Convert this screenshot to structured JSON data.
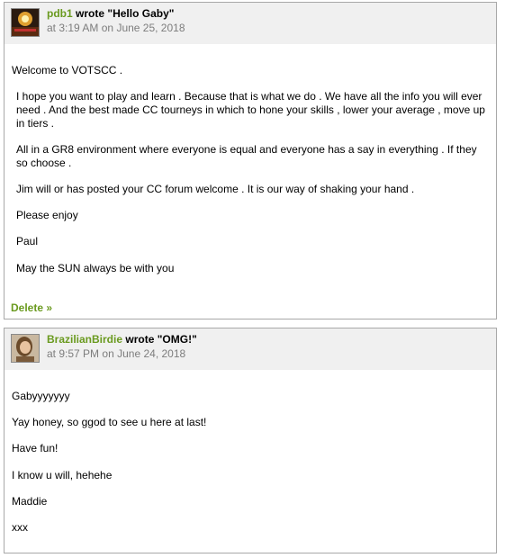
{
  "posts": [
    {
      "author": "pdb1",
      "wrote_label": "wrote",
      "title": "\"Hello Gaby\"",
      "time_prefix": "at",
      "time": "3:19 AM",
      "date_prefix": "on",
      "date": "June 25, 2018",
      "paragraphs": [
        "Welcome to VOTSCC .",
        "I hope you want to play and learn . Because that is what we do . We have all the info you will ever need . And the best made CC tourneys in which to hone your skills , lower your average , move up in tiers .",
        "All in a GR8 environment where everyone is equal and everyone has a say in everything . If they so choose .",
        "Jim will or has posted your CC forum welcome . It is our way of shaking your hand .",
        "Please enjoy",
        "Paul",
        "May the SUN always be with you"
      ],
      "delete_label": "Delete »"
    },
    {
      "author": "BrazilianBirdie",
      "wrote_label": "wrote",
      "title": "\"OMG!\"",
      "time_prefix": "at",
      "time": "9:57 PM",
      "date_prefix": "on",
      "date": "June 24, 2018",
      "paragraphs": [
        "Gabyyyyyyy",
        "Yay honey, so ggod to see u here at last!",
        "Have fun!",
        "I know u will, hehehe",
        "Maddie",
        "xxx"
      ]
    }
  ],
  "colors": {
    "author": "#6a9a1f",
    "meta": "#7d7d7d",
    "header_bg": "#f0f0f0",
    "border": "#a8a8a8"
  }
}
